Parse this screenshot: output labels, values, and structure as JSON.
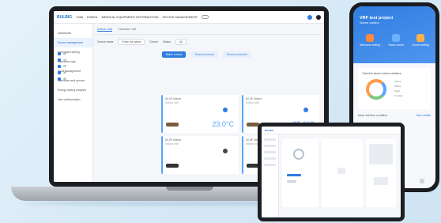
{
  "laptop": {
    "brand": "BULBIG",
    "topbar": {
      "item1": "1065",
      "item2": "BJ5001",
      "item3": "MEDICAL EQUIPMENT DISTRIBUTION",
      "item4": "DEVICE MANAGEMENT"
    },
    "sidebar": [
      {
        "label": "Dashboard",
        "active": false
      },
      {
        "label": "Device management",
        "active": true
      },
      {
        "label": "Scheduled setting",
        "active": false
      },
      {
        "label": "Operation logs",
        "active": false
      },
      {
        "label": "Fault management",
        "active": false
      },
      {
        "label": "Operation and service",
        "active": false
      },
      {
        "label": "Energy saving analysis",
        "active": false
      },
      {
        "label": "User authorization",
        "active": false
      }
    ],
    "tabs": [
      {
        "label": "Indoor unit",
        "on": true
      },
      {
        "label": "Outdoor unit",
        "on": false
      }
    ],
    "filters": {
      "f1": "Device name",
      "f2": "Enter the name",
      "f3": "Device",
      "f4": "Status",
      "f5": "All"
    },
    "tree": [
      "All",
      "1F",
      "2F",
      "3F",
      "4F"
    ],
    "actions": [
      "Batch control",
      "Send command",
      "Device schedule"
    ],
    "cards": [
      {
        "name": "02-1F Indoor",
        "sub": "Indoor unit",
        "temp": "23.0°C"
      },
      {
        "name": "02-2F Indoor",
        "sub": "Indoor unit",
        "temp": "25.0°C"
      },
      {
        "name": "02-3F Indoor",
        "sub": "Indoor unit",
        "temp": ""
      },
      {
        "name": "02-4F Indoor",
        "sub": "Indoor unit",
        "temp": ""
      }
    ]
  },
  "phone": {
    "title": "VRF test project",
    "subtitle": "Scene control",
    "scenes": [
      {
        "label": "Welcome setting",
        "color": "o"
      },
      {
        "label": "Warm scene",
        "color": "b"
      },
      {
        "label": "Scene setting",
        "color": "p"
      }
    ],
    "energy_title": "Total this device status statistics",
    "legend": [
      "Online",
      "Offline",
      "Fault",
      "Unused"
    ],
    "list_left": "Near real-time condition",
    "list_right": "View details"
  },
  "colors": {
    "accent": "#2f7de1",
    "temp": "#5aa3ff"
  }
}
